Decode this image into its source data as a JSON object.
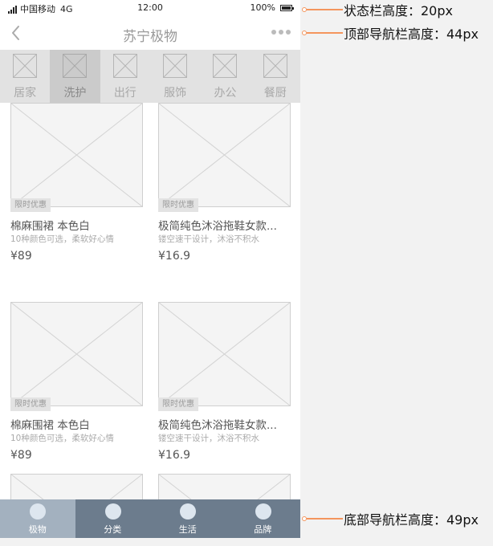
{
  "status_bar": {
    "carrier": "中国移动",
    "network": "4G",
    "time": "12:00",
    "battery": "100%"
  },
  "navbar": {
    "title": "苏宁极物",
    "back_icon": "chevron-left-icon",
    "more_icon": "more-dots-icon"
  },
  "categories": [
    {
      "label": "居家",
      "active": false
    },
    {
      "label": "洗护",
      "active": true
    },
    {
      "label": "出行",
      "active": false
    },
    {
      "label": "服饰",
      "active": false
    },
    {
      "label": "办公",
      "active": false
    },
    {
      "label": "餐厨",
      "active": false
    }
  ],
  "products": [
    {
      "badge": "限时优惠",
      "name": "棉麻围裙 本色白",
      "desc": "10种颜色可选，柔软好心情",
      "price": "¥89"
    },
    {
      "badge": "限时优惠",
      "name": "极简纯色沐浴拖鞋女款...",
      "desc": "镂空速干设计，沐浴不积水",
      "price": "¥16.9"
    },
    {
      "badge": "限时优惠",
      "name": "棉麻围裙 本色白",
      "desc": "10种颜色可选，柔软好心情",
      "price": "¥89"
    },
    {
      "badge": "限时优惠",
      "name": "极简纯色沐浴拖鞋女款...",
      "desc": "镂空速干设计，沐浴不积水",
      "price": "¥16.9"
    }
  ],
  "tabbar": [
    {
      "label": "极物",
      "active": true
    },
    {
      "label": "分类",
      "active": false
    },
    {
      "label": "生活",
      "active": false
    },
    {
      "label": "品牌",
      "active": false
    }
  ],
  "annotations": [
    {
      "text": "状态栏高度：20px"
    },
    {
      "text": "顶部导航栏高度：44px"
    },
    {
      "text": "底部导航栏高度：49px"
    }
  ],
  "colors": {
    "tabbar_bg": "#6c7c8d",
    "tabbar_active": "#a3b1bf",
    "category_bg": "#e2e2e2",
    "category_active": "#cbcbcb",
    "annotation_accent": "#f4955d"
  }
}
